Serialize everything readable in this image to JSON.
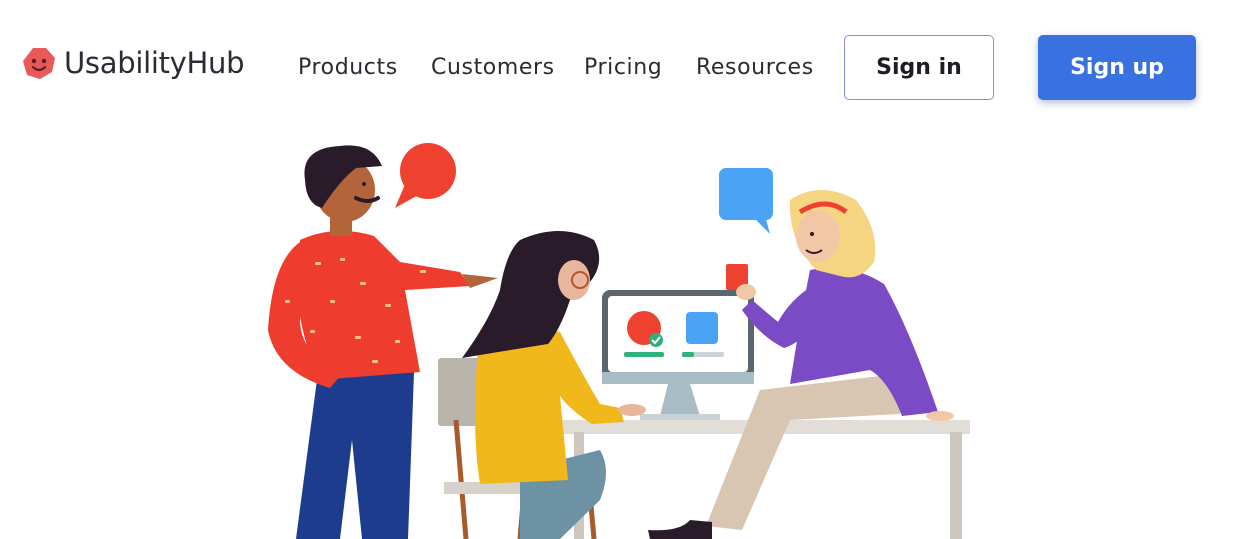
{
  "brand": {
    "name": "UsabilityHub",
    "logo_icon": "smiling-hexagon-icon",
    "logo_color": "#e8595a"
  },
  "nav": {
    "items": [
      {
        "label": "Products"
      },
      {
        "label": "Customers"
      },
      {
        "label": "Pricing"
      },
      {
        "label": "Resources"
      }
    ]
  },
  "auth": {
    "signin_label": "Sign in",
    "signup_label": "Sign up"
  },
  "colors": {
    "accent": "#3972e0",
    "signin_border": "#8a8ee0",
    "text": "#2b2b33"
  },
  "illustration": {
    "icon": "team-collaboration-illustration",
    "speech_bubbles": [
      "red-speech-bubble-icon",
      "blue-speech-bubble-icon"
    ]
  }
}
